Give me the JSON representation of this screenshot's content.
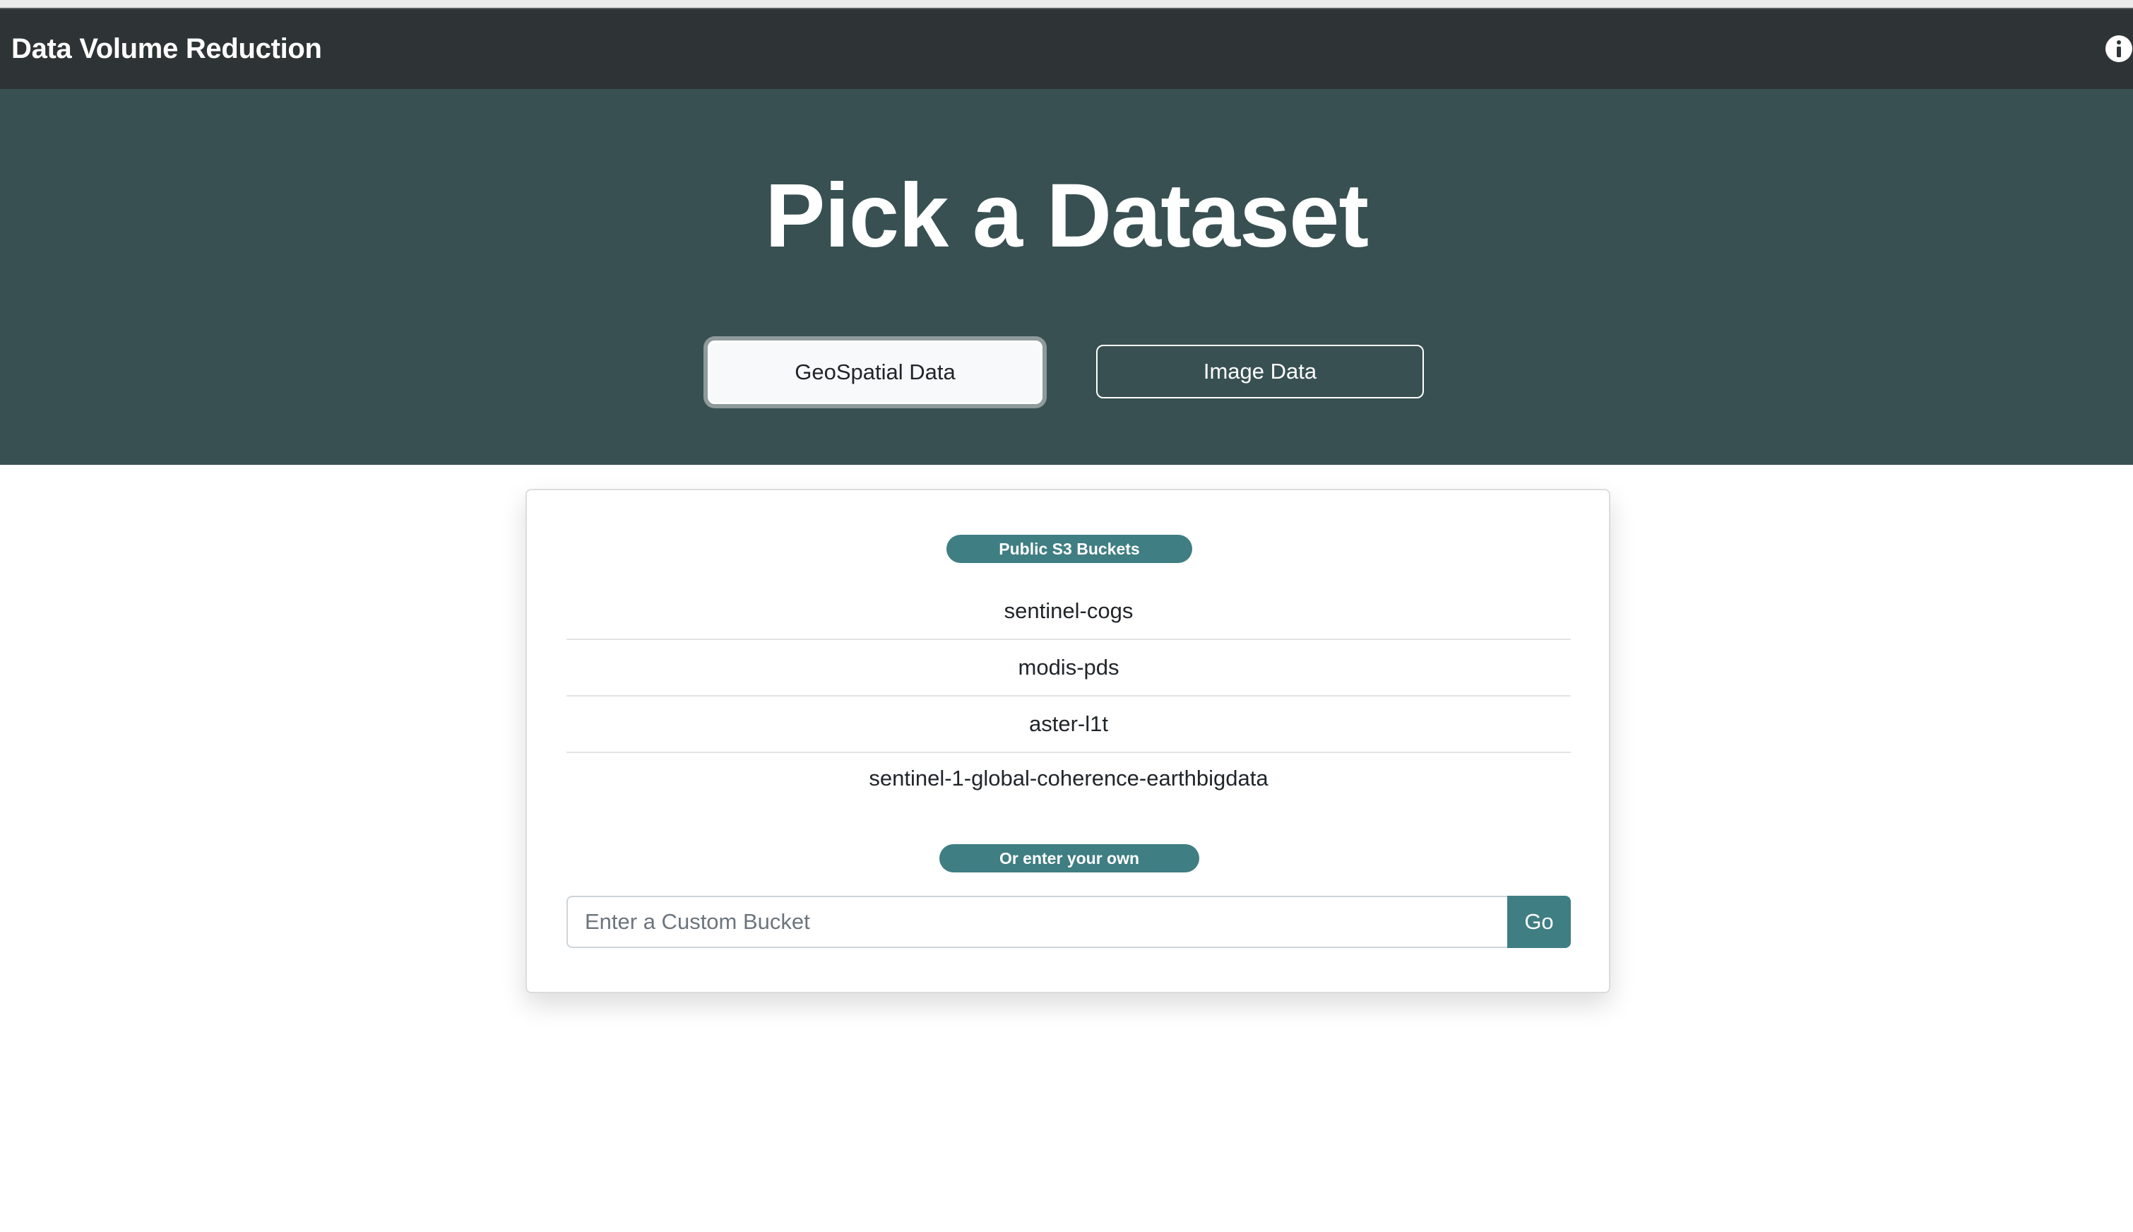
{
  "navbar": {
    "title": "Data Volume Reduction",
    "info_icon": "info-circle-icon"
  },
  "hero": {
    "title": "Pick a Dataset",
    "buttons": {
      "geospatial": "GeoSpatial Data",
      "image": "Image Data"
    },
    "selected": "geospatial"
  },
  "card": {
    "public_label": "Public S3 Buckets",
    "buckets": [
      "sentinel-cogs",
      "modis-pds",
      "aster-l1t",
      "sentinel-1-global-coherence-earthbigdata"
    ],
    "custom_label": "Or enter your own",
    "custom_input": {
      "value": "",
      "placeholder": "Enter a Custom Bucket"
    },
    "go_label": "Go"
  },
  "colors": {
    "navbar_bg": "#2e3435",
    "hero_bg": "#385052",
    "accent": "#3f7e82"
  }
}
